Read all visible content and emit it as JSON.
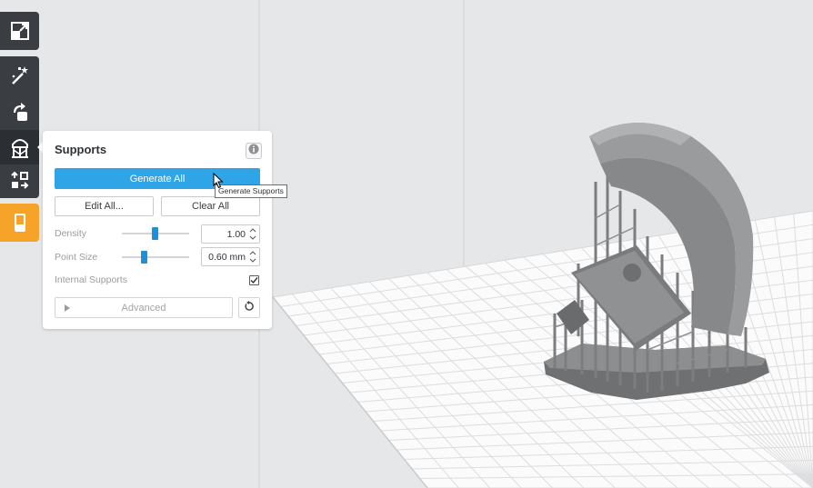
{
  "toolbar": {
    "tools": [
      {
        "icon": "resize-icon"
      },
      {
        "icon": "magic-wand-icon"
      },
      {
        "icon": "orientation-icon"
      },
      {
        "icon": "supports-icon"
      },
      {
        "icon": "layout-icon"
      },
      {
        "icon": "print-icon",
        "color": "#f6a329"
      }
    ]
  },
  "supports_panel": {
    "title": "Supports",
    "info_icon": "info-icon",
    "generate_all_label": "Generate All",
    "edit_all_label": "Edit All...",
    "clear_all_label": "Clear All",
    "density": {
      "label": "Density",
      "value": "1.00",
      "slider_fraction": 0.49
    },
    "point_size": {
      "label": "Point Size",
      "value": "0.60 mm",
      "slider_fraction": 0.31
    },
    "internal_supports": {
      "label": "Internal Supports",
      "checked": true
    },
    "advanced_label": "Advanced",
    "reset_icon": "reset-icon"
  },
  "tooltip": {
    "text": "Generate Supports"
  },
  "colors": {
    "accent": "#2fa4e7",
    "toolbar_bg": "#3a3d42",
    "highlight": "#f6a329",
    "viewport_bg": "#e6e7e9",
    "model": "#8a8b8d"
  }
}
